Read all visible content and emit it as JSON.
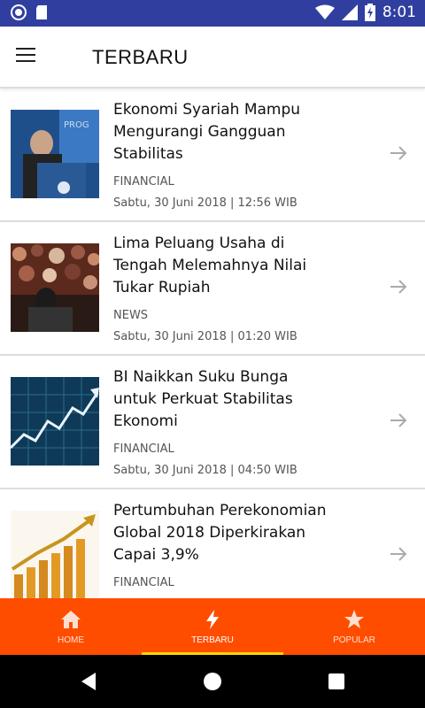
{
  "status_bar": {
    "time": "8:01"
  },
  "app_bar": {
    "title": "TERBARU"
  },
  "articles": [
    {
      "title": "Ekonomi Syariah Mampu Mengurangi Gangguan Stabilitas",
      "category": "FINANCIAL",
      "date": "Sabtu, 30 Juni 2018 | 12:56 WIB"
    },
    {
      "title": "Lima Peluang Usaha di Tengah Melemahnya Nilai Tukar Rupiah",
      "category": "NEWS",
      "date": "Sabtu, 30 Juni 2018 | 01:20 WIB"
    },
    {
      "title": "BI Naikkan Suku Bunga untuk Perkuat Stabilitas Ekonomi",
      "category": "FINANCIAL",
      "date": "Sabtu, 30 Juni 2018 | 04:50 WIB"
    },
    {
      "title": "Pertumbuhan Perekonomian Global 2018 Diperkirakan Capai 3,9%",
      "category": "FINANCIAL",
      "date": ""
    }
  ],
  "bottom_nav": {
    "items": [
      {
        "label": "HOME",
        "icon": "home-icon"
      },
      {
        "label": "TERBARU",
        "icon": "bolt-icon"
      },
      {
        "label": "POPULAR",
        "icon": "star-icon"
      }
    ],
    "active": "TERBARU"
  },
  "colors": {
    "status_bar": "#303f9f",
    "accent": "#ff4d00",
    "active_indicator": "#ffd400"
  }
}
